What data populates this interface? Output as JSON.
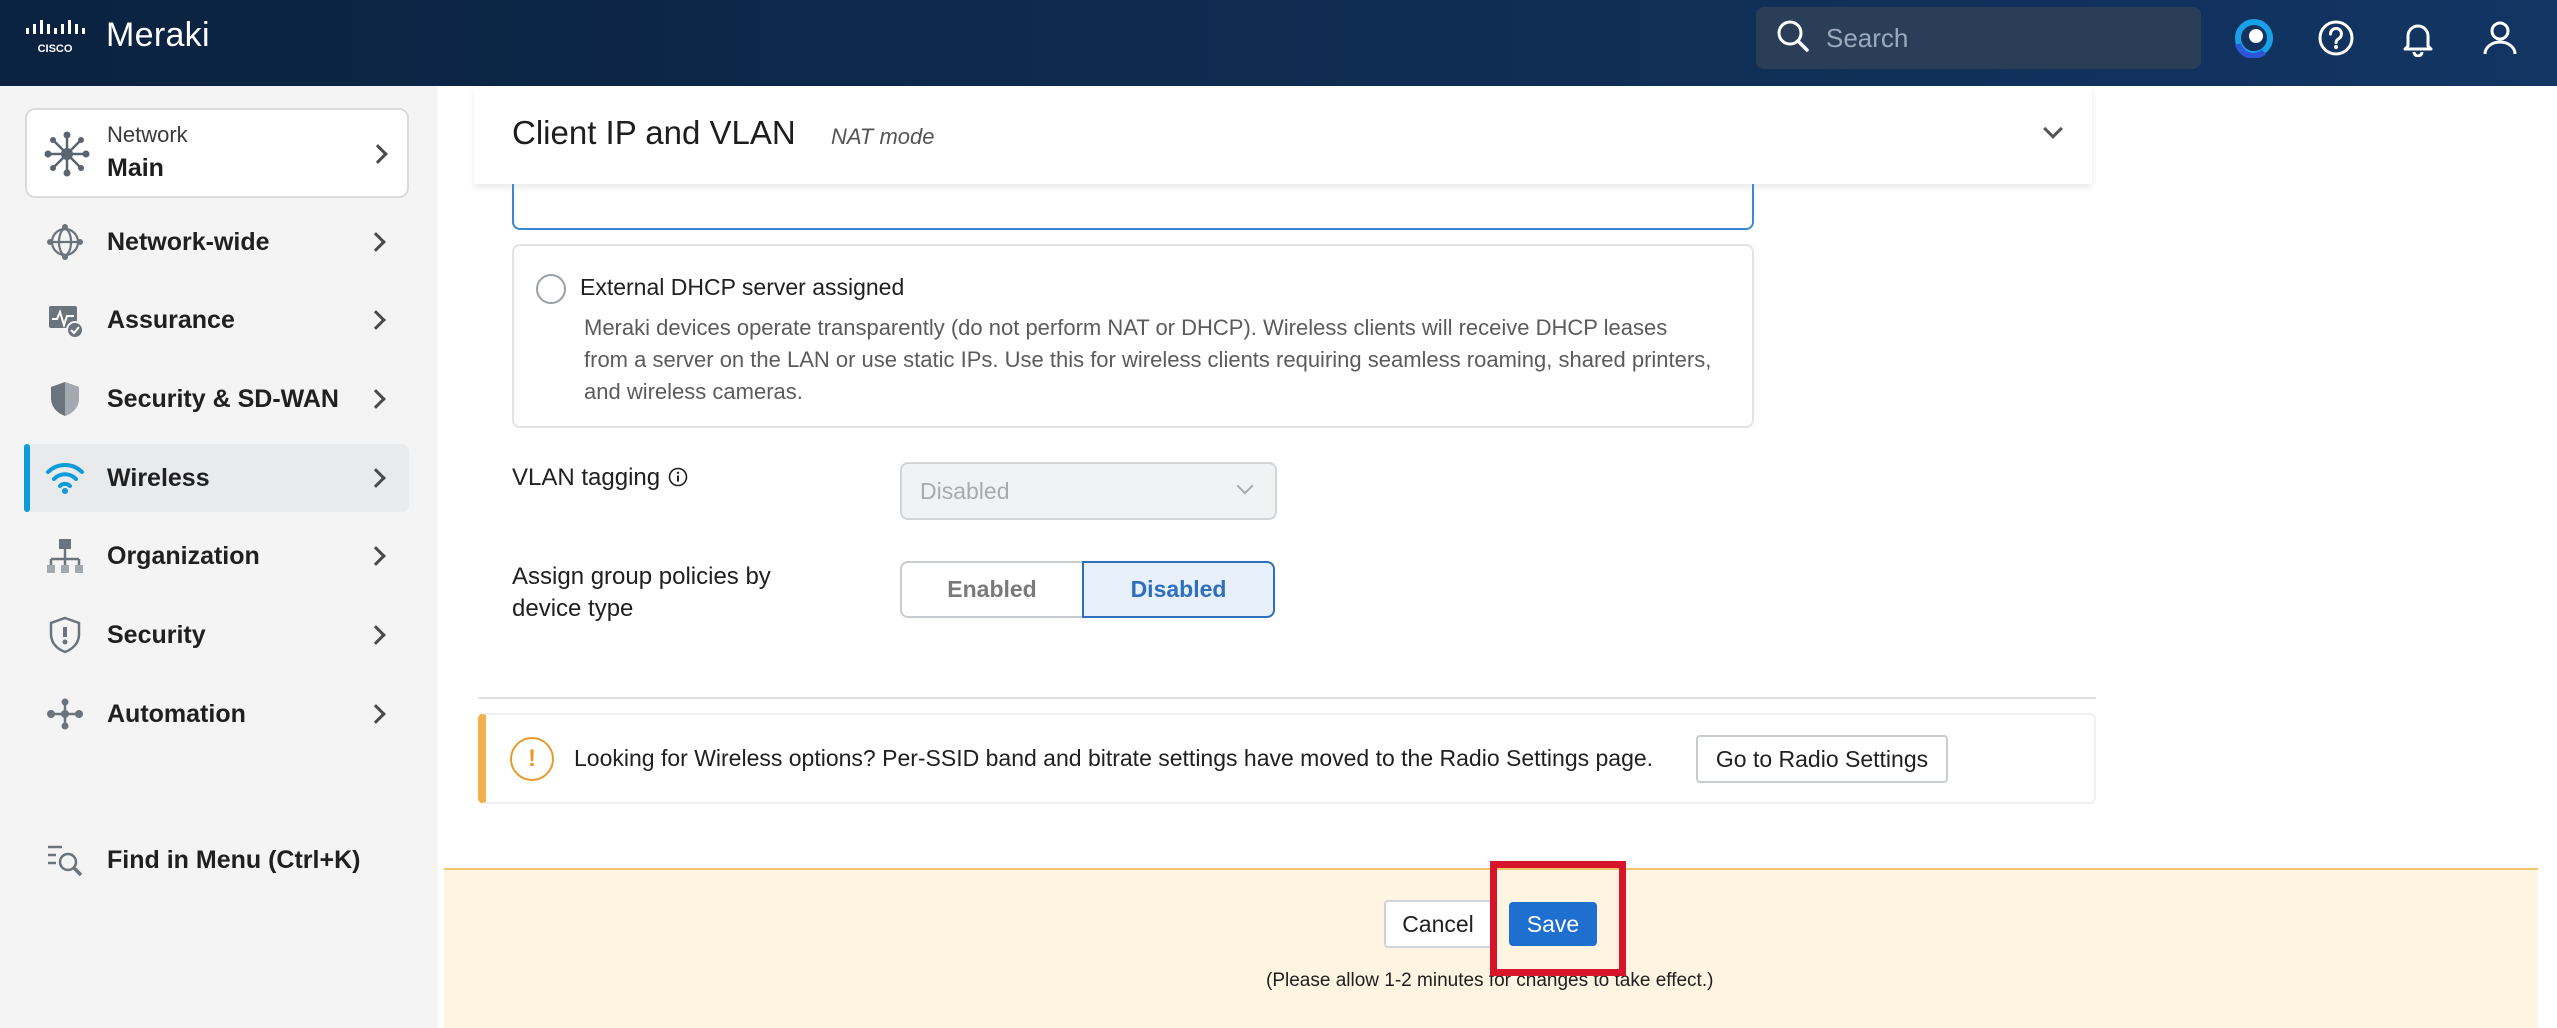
{
  "app": {
    "brand": "Meraki",
    "logo_text": "CISCO",
    "colors": {
      "topbar": "#0f2c52",
      "accent": "#0b9bd8",
      "primary": "#1f6fd0",
      "warning": "#f2b14c",
      "highlight": "#d7152a"
    }
  },
  "topbar": {
    "search_placeholder": "Search",
    "icons": [
      "search-icon",
      "copilot-icon",
      "help-icon",
      "bell-icon",
      "user-icon"
    ]
  },
  "sidebar": {
    "network": {
      "label": "Network",
      "name": "Main"
    },
    "items": [
      {
        "label": "Network-wide",
        "icon": "network-wide-icon"
      },
      {
        "label": "Assurance",
        "icon": "assurance-icon"
      },
      {
        "label": "Security & SD-WAN",
        "icon": "shield-icon"
      },
      {
        "label": "Wireless",
        "icon": "wifi-icon",
        "active": true
      },
      {
        "label": "Organization",
        "icon": "organization-icon"
      },
      {
        "label": "Security",
        "icon": "security-shield-icon"
      },
      {
        "label": "Automation",
        "icon": "automation-icon"
      }
    ],
    "find": {
      "label": "Find in Menu (Ctrl+K)",
      "icon": "find-menu-icon"
    }
  },
  "section": {
    "title": "Client IP and VLAN",
    "subtitle": "NAT mode"
  },
  "option": {
    "title": "External DHCP server assigned",
    "description": "Meraki devices operate transparently (do not perform NAT or DHCP). Wireless clients will receive DHCP leases from a server on the LAN or use static IPs. Use this for wireless clients requiring seamless roaming, shared printers, and wireless cameras."
  },
  "vlan_tagging": {
    "label": "VLAN tagging",
    "value": "Disabled"
  },
  "group_policies": {
    "label": "Assign group policies by device type",
    "enabled_label": "Enabled",
    "disabled_label": "Disabled",
    "selected": "Disabled"
  },
  "notice": {
    "message": "Looking for Wireless options? Per-SSID band and bitrate settings have moved to the Radio Settings page.",
    "button": "Go to Radio Settings"
  },
  "footer": {
    "cancel": "Cancel",
    "save": "Save",
    "note": "(Please allow 1-2 minutes for changes to take effect.)"
  }
}
